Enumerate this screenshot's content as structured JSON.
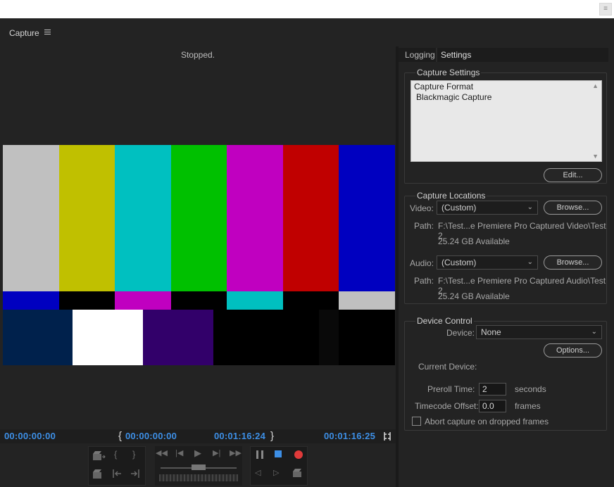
{
  "window": {
    "title_button": "≡"
  },
  "panel": {
    "title": "Capture"
  },
  "monitor": {
    "status": "Stopped.",
    "timecode_start": "00:00:00:00",
    "timecode_in": "00:00:00:00",
    "timecode_out": "00:01:16:24",
    "timecode_duration": "00:01:16:25",
    "bracket_in": "{",
    "bracket_out": "}",
    "bars_colors": {
      "top": [
        "#c0c0c0",
        "#c0c000",
        "#00c0c0",
        "#00c000",
        "#c000c0",
        "#c00000",
        "#0000c0"
      ],
      "middle": [
        "#0000c0",
        "#000000",
        "#c000c0",
        "#000000",
        "#00c0c0",
        "#000000",
        "#c0c0c0"
      ],
      "bottom": [
        "#00214c",
        "#ffffff",
        "#32006a",
        "#000000",
        "#000000",
        "#090909",
        "#000000"
      ]
    }
  },
  "tabs": [
    {
      "label": "Logging",
      "active": false
    },
    {
      "label": "Settings",
      "active": true
    }
  ],
  "capture_settings": {
    "title": "Capture Settings",
    "format_label": "Capture Format",
    "format_value": "Blackmagic Capture",
    "edit_button": "Edit..."
  },
  "capture_locations": {
    "title": "Capture Locations",
    "video_label": "Video:",
    "video_value": "(Custom)",
    "video_browse": "Browse...",
    "video_path_label": "Path:",
    "video_path": "F:\\Test...e Premiere Pro Captured Video\\Test 2",
    "video_available": "25.24 GB Available",
    "audio_label": "Audio:",
    "audio_value": "(Custom)",
    "audio_browse": "Browse...",
    "audio_path_label": "Path:",
    "audio_path": "F:\\Test...e Premiere Pro Captured Audio\\Test 2",
    "audio_available": "25.24 GB Available"
  },
  "device_control": {
    "title": "Device Control",
    "device_label": "Device:",
    "device_value": "None",
    "options_button": "Options...",
    "current_device_label": "Current Device:",
    "preroll_label": "Preroll Time:",
    "preroll_value": "2",
    "preroll_unit": "seconds",
    "offset_label": "Timecode Offset:",
    "offset_value": "0.0",
    "offset_unit": "frames",
    "abort_label": "Abort capture on dropped frames",
    "abort_checked": false
  },
  "colors": {
    "accent_timecode": "#3d8fe6",
    "record": "#e03a3a",
    "stop": "#3d8fe6"
  }
}
